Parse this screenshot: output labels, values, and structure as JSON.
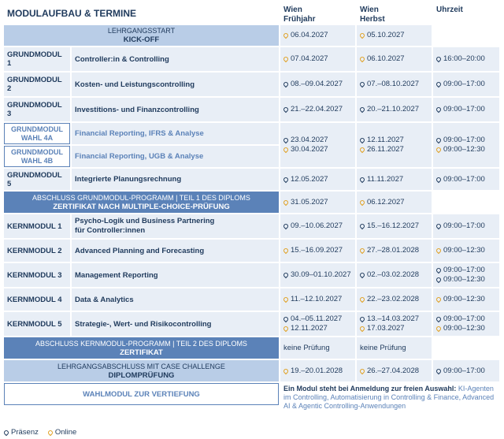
{
  "header": {
    "title": "MODULAUFBAU & TERMINE",
    "col_spring": "Wien\nFrühjahr",
    "col_fall": "Wien\nHerbst",
    "col_time": "Uhrzeit"
  },
  "rows": {
    "kickoff": {
      "line1": "LEHRGANGSSTART",
      "line2": "KICK-OFF",
      "spring": "06.04.2027",
      "fall": "05.10.2027"
    },
    "gm1": {
      "code": "GRUNDMODUL 1",
      "name": "Controller:in & Controlling",
      "spring": "07.04.2027",
      "fall": "06.10.2027",
      "time": "16:00–20:00"
    },
    "gm2": {
      "code": "GRUNDMODUL 2",
      "name": "Kosten- und Leistungscontrolling",
      "spring": "08.–09.04.2027",
      "fall": "07.–08.10.2027",
      "time": "09:00–17:00"
    },
    "gm3": {
      "code": "GRUNDMODUL 3",
      "name": "Investitions- und Finanzcontrolling",
      "spring": "21.–22.04.2027",
      "fall": "20.–21.10.2027",
      "time": "09:00–17:00"
    },
    "gm4": {
      "code_a": "GRUNDMODUL WAHL 4A",
      "name_a": "Financial Reporting, IFRS & Analyse",
      "code_b": "GRUNDMODUL WAHL 4B",
      "name_b": "Financial Reporting, UGB & Analyse",
      "spring_1": "23.04.2027",
      "spring_2": "30.04.2027",
      "fall_1": "12.11.2027",
      "fall_2": "26.11.2027",
      "time_1": "09:00–17:00",
      "time_2": "09:00–12:30"
    },
    "gm5": {
      "code": "GRUNDMODUL 5",
      "name": "Integrierte Planungsrechnung",
      "spring": "12.05.2027",
      "fall": "11.11.2027",
      "time": "09:00–17:00"
    },
    "abs1": {
      "line1": "ABSCHLUSS GRUNDMODUL-PROGRAMM | TEIL 1 DES DIPLOMS",
      "line2": "ZERTIFIKAT NACH MULTIPLE-CHOICE-PRÜFUNG",
      "spring": "31.05.2027",
      "fall": "06.12.2027"
    },
    "km1": {
      "code": "KERNMODUL 1",
      "name_1": "Psycho-Logik und Business Partnering",
      "name_2": "für Controller:innen",
      "spring": "09.–10.06.2027",
      "fall": "15.–16.12.2027",
      "time": "09:00–17:00"
    },
    "km2": {
      "code": "KERNMODUL 2",
      "name": "Advanced Planning and Forecasting",
      "spring": "15.–16.09.2027",
      "fall": "27.–28.01.2028",
      "time": "09:00–12:30"
    },
    "km3": {
      "code": "KERNMODUL 3",
      "name": "Management Reporting",
      "spring": "30.09–01.10.2027",
      "fall": "02.–03.02.2028",
      "time_1": "09:00–17:00",
      "time_2": "09:00–12:30"
    },
    "km4": {
      "code": "KERNMODUL 4",
      "name": "Data & Analytics",
      "spring": "11.–12.10.2027",
      "fall": "22.–23.02.2028",
      "time": "09:00–12:30"
    },
    "km5": {
      "code": "KERNMODUL 5",
      "name": "Strategie-, Wert- und Risikocontrolling",
      "spring_1": "04.–05.11.2027",
      "spring_2": "12.11.2027",
      "fall_1": "13.–14.03.2027",
      "fall_2": "17.03.2027",
      "time_1": "09:00–17:00",
      "time_2": "09:00–12:30"
    },
    "abs2": {
      "line1": "ABSCHLUSS KERNMODUL-PROGRAMM | TEIL 2 DES DIPLOMS",
      "line2": "ZERTIFIKAT",
      "spring": "keine Prüfung",
      "fall": "keine Prüfung"
    },
    "abs3": {
      "line1": "LEHRGANGSABSCHLUSS MIT CASE CHALLENGE",
      "line2": "DIPLOMPRÜFUNG",
      "spring": "19.–20.01.2028",
      "fall": "26.–27.04.2028",
      "time": "09:00–17:00"
    },
    "wahl": {
      "label": "WAHLMODUL ZUR VERTIEFUNG",
      "note_bold": "Ein Modul steht bei Anmeldung zur freien Auswahl:",
      "note_text": " KI-Agenten im Controlling, Automatisierung in Controlling & Finance, Advanced AI & Agentic Controlling-Anwendungen"
    }
  },
  "legend": {
    "present": "Präsenz",
    "online": "Online"
  },
  "colors": {
    "dark_blue": "#1f3a5c",
    "band_dark": "#5b82b8",
    "band_light": "#b9cde7",
    "cell_bg": "#e8eef6",
    "online": "#e0a020"
  },
  "icons": {
    "present": "location-pin-icon",
    "online": "location-pin-online-icon"
  }
}
